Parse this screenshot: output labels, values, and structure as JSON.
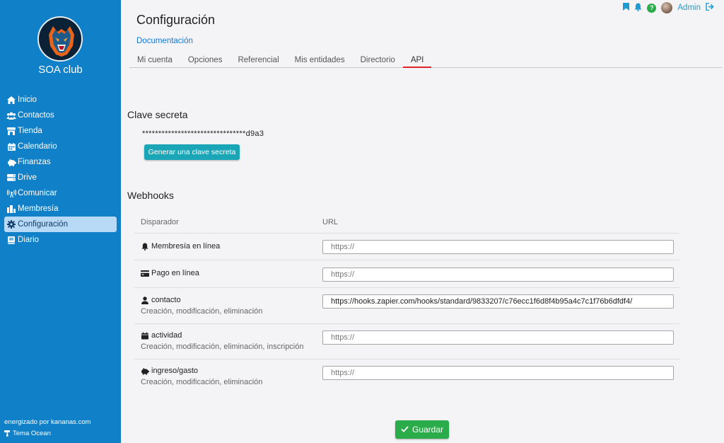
{
  "sidebar": {
    "club_name": "SOA club",
    "items": [
      {
        "label": "Inicio",
        "icon": "home-icon"
      },
      {
        "label": "Contactos",
        "icon": "users-icon"
      },
      {
        "label": "Tienda",
        "icon": "store-icon"
      },
      {
        "label": "Calendario",
        "icon": "calendar-icon"
      },
      {
        "label": "Finanzas",
        "icon": "piggy-bank-icon"
      },
      {
        "label": "Drive",
        "icon": "drive-icon"
      },
      {
        "label": "Comunicar",
        "icon": "broadcast-icon"
      },
      {
        "label": "Membresía",
        "icon": "membership-icon"
      },
      {
        "label": "Configuración",
        "icon": "gear-icon",
        "active": true
      },
      {
        "label": "Diario",
        "icon": "book-icon"
      }
    ],
    "powered_by": "energizado por kananas.com",
    "theme": "Tema Ocean"
  },
  "topbar": {
    "user": "Admin",
    "help": "?"
  },
  "header": {
    "title": "Configuración",
    "doc_link": "Documentación",
    "tabs": [
      "Mi cuenta",
      "Opciones",
      "Referencial",
      "Mis entidades",
      "Directorio",
      "API"
    ],
    "active_tab": "API"
  },
  "secret": {
    "title": "Clave secreta",
    "masked": "********************************d9a3",
    "button": "Generar una clave secreta"
  },
  "webhooks": {
    "title": "Webhooks",
    "col_trigger": "Disparador",
    "col_url": "URL",
    "rows": [
      {
        "trigger": "Membresía en línea",
        "icon": "bell-icon",
        "sub": "",
        "url": "",
        "placeholder": "https://"
      },
      {
        "trigger": "Pago en línea",
        "icon": "credit-card-icon",
        "sub": "",
        "url": "",
        "placeholder": "https://"
      },
      {
        "trigger": "contacto",
        "icon": "user-icon",
        "sub": "Creación, modificación, eliminación",
        "url": "https://hooks.zapier.com/hooks/standard/9833207/c76ecc1f6d8f4b95a4c7c1f76b6dfdf4/",
        "placeholder": "https://"
      },
      {
        "trigger": "actividad",
        "icon": "calendar-icon",
        "sub": "Creación, modificación, eliminación, inscripción",
        "url": "",
        "placeholder": "https://"
      },
      {
        "trigger": "ingreso/gasto",
        "icon": "piggy-bank-icon",
        "sub": "Creación, modificación, eliminación",
        "url": "",
        "placeholder": "https://"
      }
    ]
  },
  "save_label": "Guardar",
  "colors": {
    "sidebar": "#1080c8",
    "active_tab_underline": "#e0242c",
    "generate_button": "#1ba6b8",
    "save_button": "#2bac4a",
    "link": "#1876d2"
  }
}
